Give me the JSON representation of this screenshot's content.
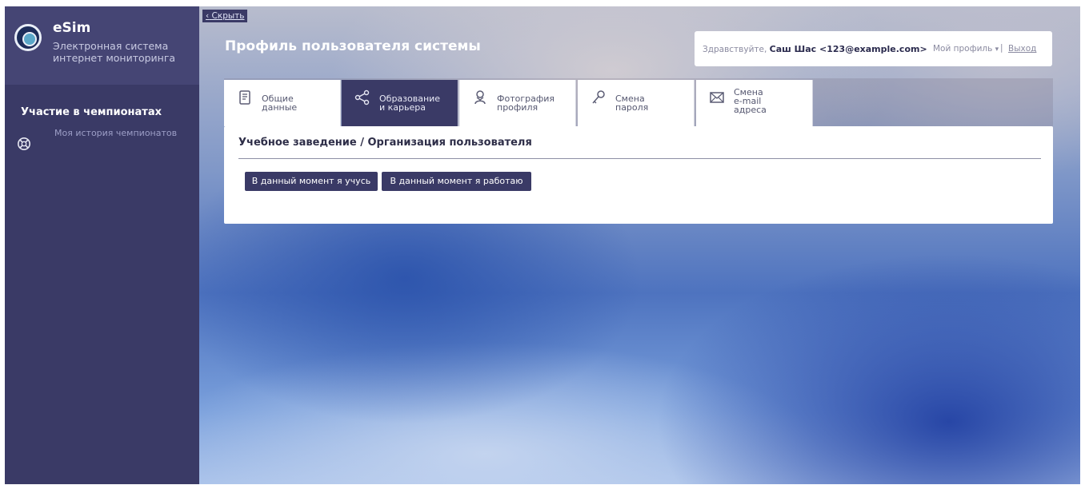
{
  "app": {
    "title": "eSim",
    "subtitle_line1": "Электронная система",
    "subtitle_line2": "интернет мониторинга"
  },
  "sidebar": {
    "section_title": "Участие в чемпионатах",
    "items": [
      {
        "label": "Моя история чемпионатов",
        "icon": "championship-icon"
      }
    ]
  },
  "hide_link": "Скрыть",
  "page_title": "Профиль пользователя системы",
  "user": {
    "greeting": "Здравствуйте,",
    "name": "Саш Шас <123@example.com>",
    "profile_menu": "Мой профиль",
    "separator": "|",
    "logout": "Выход"
  },
  "tabs": [
    {
      "line1": "Общие",
      "line2": "данные",
      "line3": "",
      "icon": "document-icon",
      "active": false
    },
    {
      "line1": "Образование",
      "line2": "и карьера",
      "line3": "",
      "icon": "share-icon",
      "active": true
    },
    {
      "line1": "Фотография",
      "line2": "профиля",
      "line3": "",
      "icon": "person-icon",
      "active": false
    },
    {
      "line1": "Смена",
      "line2": "пароля",
      "line3": "",
      "icon": "key-icon",
      "active": false
    },
    {
      "line1": "Смена",
      "line2": "e-mail",
      "line3": "адреса",
      "icon": "envelope-icon",
      "active": false
    }
  ],
  "panel": {
    "title": "Учебное заведение / Организация пользователя",
    "buttons": {
      "study": "В данный момент я учусь",
      "work": "В данный момент я работаю"
    }
  },
  "colors": {
    "sidebar": "#3a3a66",
    "sidebar_header": "#454574",
    "accent": "#3a3a66"
  }
}
